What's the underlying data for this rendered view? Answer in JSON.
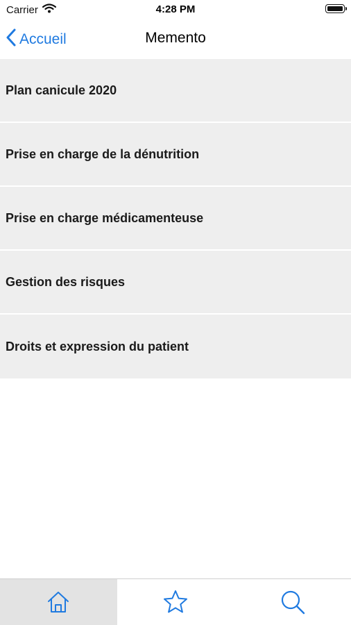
{
  "status_bar": {
    "carrier": "Carrier",
    "time": "4:28 PM"
  },
  "nav": {
    "back_label": "Accueil",
    "title": "Memento"
  },
  "list": {
    "items": [
      {
        "label": "Plan canicule 2020"
      },
      {
        "label": "Prise en charge de la dénutrition"
      },
      {
        "label": "Prise en charge médicamenteuse"
      },
      {
        "label": "Gestion des risques"
      },
      {
        "label": "Droits et expression du patient"
      }
    ]
  },
  "tab_bar": {
    "tabs": [
      {
        "icon": "home-icon",
        "selected": true
      },
      {
        "icon": "star-icon",
        "selected": false
      },
      {
        "icon": "search-icon",
        "selected": false
      }
    ]
  },
  "colors": {
    "accent": "#1f7ae0",
    "list_bg": "#eeeeee",
    "selected_tab_bg": "#e3e3e3"
  }
}
